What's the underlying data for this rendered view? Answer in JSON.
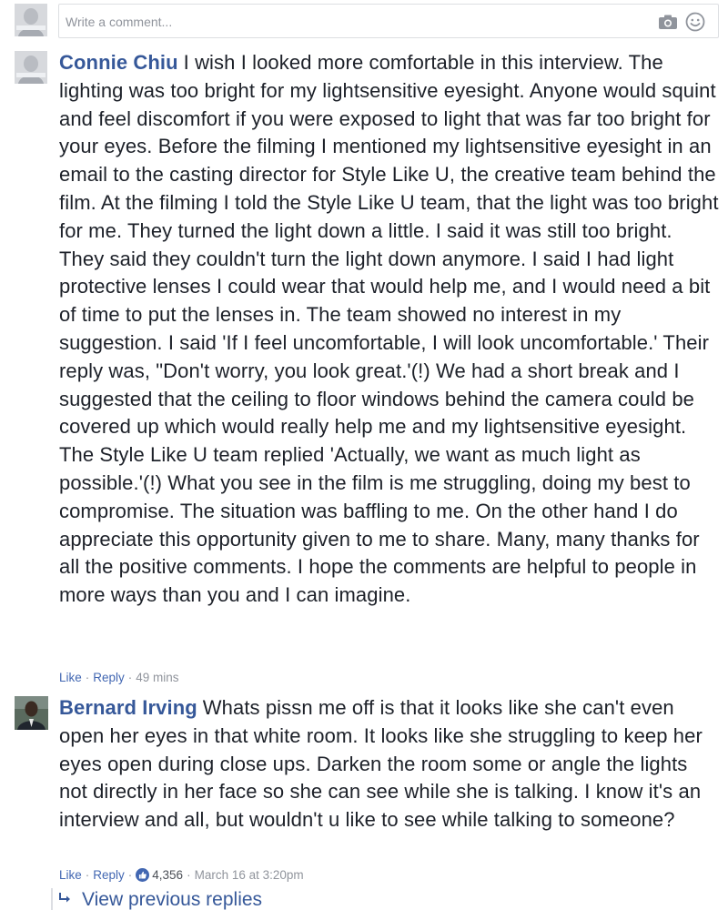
{
  "composer": {
    "placeholder": "Write a comment...",
    "avatar_icon": "profile-photo-icon",
    "camera_icon": "camera-icon",
    "emoji_icon": "emoji-icon"
  },
  "comments": [
    {
      "author": "Connie Chiu",
      "avatar_icon": "profile-photo-icon",
      "text": "I wish I looked more comfortable in this interview. The lighting was too bright for my lightsensitive eyesight. Anyone would squint and feel discomfort if you were exposed to light that was far too bright for your eyes. Before the filming I mentioned my lightsensitive eyesight in an email to the casting director for Style Like U, the creative team behind the film. At the filming I told the Style Like U team, that the light was too bright for me. They turned the light down a little. I said it was still too bright. They said they couldn't turn the light down anymore. I said I had light protective lenses I could wear that would help me, and I would need a bit of time to put the lenses in. The team showed no interest in my suggestion. I said 'If I feel uncomfortable, I will look uncomfortable.' Their reply was, \"Don't worry, you look great.'(!) We had a short break and I suggested that the ceiling to floor windows behind the camera could be covered up which would really help me and my lightsensitive eyesight. The Style Like U team replied 'Actually, we want as much light as possible.'(!) What you see in the film is me struggling, doing my best to compromise. The situation was baffling to me. On the other hand I do appreciate this opportunity given to me to share. Many, many thanks for all the positive comments. I hope the comments are helpful to people in more ways than you and I can imagine.",
      "like_label": "Like",
      "reply_label": "Reply",
      "time": "49 mins"
    },
    {
      "author": "Bernard Irving",
      "avatar_icon": "profile-photo-icon",
      "text": "Whats pissn me off is that it looks like she can't even open her eyes in that white room. It looks like she struggling to keep her eyes open during close ups. Darken the room some or angle the lights not directly in her face so she can see while she is talking. I know it's an interview and all, but wouldn't u like to see while talking to someone?",
      "like_label": "Like",
      "reply_label": "Reply",
      "reaction_icon": "like-thumb-icon",
      "reaction_count": "4,356",
      "time": "March 16 at 3:20pm"
    }
  ],
  "replies": {
    "icon": "reply-arrow-icon",
    "label": "View previous replies"
  },
  "colors": {
    "link": "#365899",
    "action_link": "#4267b2",
    "meta": "#90949c",
    "text": "#1d2129",
    "border": "#dddfe2"
  }
}
